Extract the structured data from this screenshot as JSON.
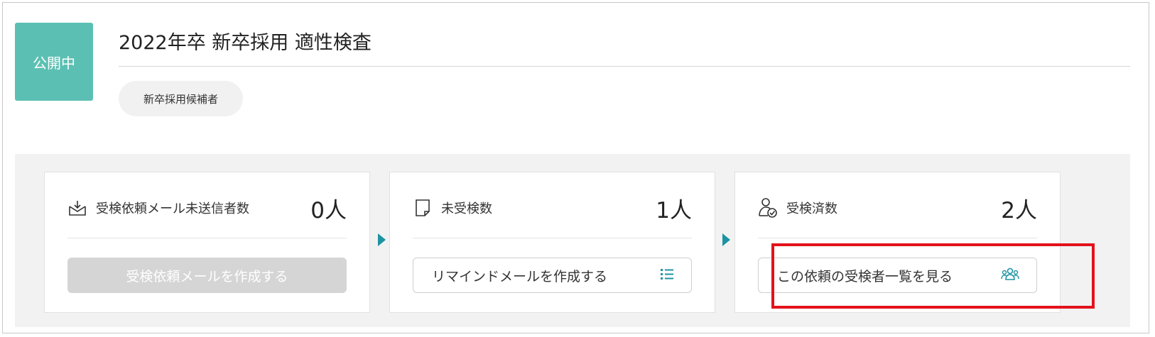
{
  "status_badge": "公開中",
  "title": "2022年卒 新卒採用 適性検査",
  "target_tag": "新卒採用候補者",
  "colors": {
    "badge_bg": "#5bc0b3",
    "accent": "#1c93a3",
    "highlight": "#e3121b",
    "disabled_button": "#d5d5d5"
  },
  "cards": [
    {
      "icon": "mail-icon",
      "label": "受検依頼メール未送信者数",
      "count": "0人",
      "button_label": "受検依頼メールを作成する",
      "button_disabled": true
    },
    {
      "icon": "document-icon",
      "label": "未受検数",
      "count": "1人",
      "button_label": "リマインドメールを作成する",
      "button_icon": "list-icon",
      "button_disabled": false
    },
    {
      "icon": "user-check-icon",
      "label": "受検済数",
      "count": "2人",
      "button_label": "この依頼の受検者一覧を見る",
      "button_icon": "users-group-icon",
      "button_disabled": false,
      "highlighted": true
    }
  ]
}
